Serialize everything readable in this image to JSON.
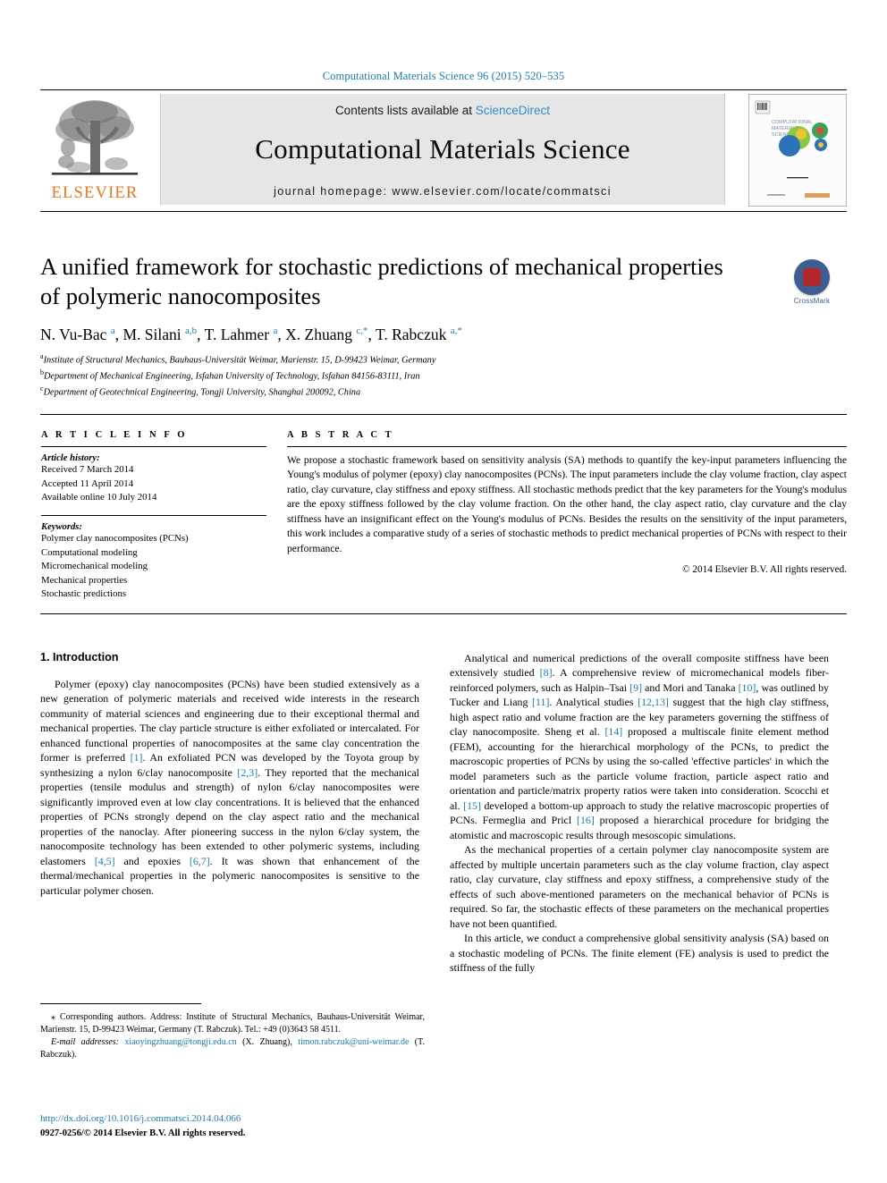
{
  "running_head": "Computational Materials Science 96 (2015) 520–535",
  "masthead": {
    "contents_prefix": "Contents lists available at ",
    "sciencedirect": "ScienceDirect",
    "journal_title": "Computational Materials Science",
    "journal_homepage": "journal homepage: www.elsevier.com/locate/commatsci",
    "publisher_logo_text": "ELSEVIER",
    "cover_thumb_title": "COMPUTATIONAL MATERIALS SCIENCE",
    "accent_color": "#1b7bb5",
    "elsevier_orange": "#E87722"
  },
  "title_block": {
    "title": "A unified framework for stochastic predictions of mechanical properties of polymeric nanocomposites",
    "crossmark_label": "CrossMark",
    "authors_html": "N. Vu-Bac <sup>a</sup>, M. Silani <sup>a,b</sup>, T. Lahmer <sup>a</sup>, X. Zhuang <sup>c,</sup><sup>*</sup>, T. Rabczuk <sup>a,</sup><sup>*</sup>",
    "affiliations": [
      "Institute of Structural Mechanics, Bauhaus-Universität Weimar, Marienstr. 15, D-99423 Weimar, Germany",
      "Department of Mechanical Engineering, Isfahan University of Technology, Isfahan 84156-83111, Iran",
      "Department of Geotechnical Engineering, Tongji University, Shanghai 200092, China"
    ],
    "affiliation_marks": [
      "a",
      "b",
      "c"
    ]
  },
  "article_info": {
    "heading": "A R T I C L E   I N F O",
    "history_label": "Article history:",
    "history": [
      "Received 7 March 2014",
      "Accepted 11 April 2014",
      "Available online 10 July 2014"
    ],
    "keywords_label": "Keywords:",
    "keywords": [
      "Polymer clay nanocomposites (PCNs)",
      "Computational modeling",
      "Micromechanical modeling",
      "Mechanical properties",
      "Stochastic predictions"
    ]
  },
  "abstract": {
    "heading": "A B S T R A C T",
    "text": "We propose a stochastic framework based on sensitivity analysis (SA) methods to quantify the key-input parameters influencing the Young's modulus of polymer (epoxy) clay nanocomposites (PCNs). The input parameters include the clay volume fraction, clay aspect ratio, clay curvature, clay stiffness and epoxy stiffness. All stochastic methods predict that the key parameters for the Young's modulus are the epoxy stiffness followed by the clay volume fraction. On the other hand, the clay aspect ratio, clay curvature and the clay stiffness have an insignificant effect on the Young's modulus of PCNs. Besides the results on the sensitivity of the input parameters, this work includes a comparative study of a series of stochastic methods to predict mechanical properties of PCNs with respect to their performance.",
    "copyright": "© 2014 Elsevier B.V. All rights reserved."
  },
  "body": {
    "section_number_title": "1. Introduction",
    "left_paragraphs": [
      {
        "parts": [
          {
            "t": "Polymer (epoxy) clay nanocomposites (PCNs) have been studied extensively as a new generation of polymeric materials and received wide interests in the research community of material sciences and engineering due to their exceptional thermal and mechanical properties. The clay particle structure is either exfoliated or intercalated. For enhanced functional properties of nanocomposites at the same clay concentration the former is preferred "
          },
          {
            "t": "[1]",
            "ref": true
          },
          {
            "t": ". An exfoliated PCN was developed by the Toyota group by synthesizing a nylon 6/clay nanocomposite "
          },
          {
            "t": "[2,3]",
            "ref": true
          },
          {
            "t": ". They reported that the mechanical properties (tensile modulus and strength) of nylon 6/clay nanocomposites were significantly improved even at low clay concentrations. It is believed that the enhanced properties of PCNs strongly depend on the clay aspect ratio and the mechanical properties of the nanoclay. After pioneering success in the nylon 6/clay system, the nanocomposite technology has been extended to other polymeric systems, including elastomers "
          },
          {
            "t": "[4,5]",
            "ref": true
          },
          {
            "t": " and epoxies "
          },
          {
            "t": "[6,7]",
            "ref": true
          },
          {
            "t": ". It was shown that enhancement of the thermal/mechanical properties in the polymeric nanocomposites is sensitive to the particular polymer chosen."
          }
        ]
      }
    ],
    "right_paragraphs": [
      {
        "parts": [
          {
            "t": "Analytical and numerical predictions of the overall composite stiffness have been extensively studied "
          },
          {
            "t": "[8]",
            "ref": true
          },
          {
            "t": ". A comprehensive review of micromechanical models fiber-reinforced polymers, such as Halpin–Tsai "
          },
          {
            "t": "[9]",
            "ref": true
          },
          {
            "t": " and Mori and Tanaka "
          },
          {
            "t": "[10]",
            "ref": true
          },
          {
            "t": ", was outlined by Tucker and Liang "
          },
          {
            "t": "[11]",
            "ref": true
          },
          {
            "t": ". Analytical studies "
          },
          {
            "t": "[12,13]",
            "ref": true
          },
          {
            "t": " suggest that the high clay stiffness, high aspect ratio and volume fraction are the key parameters governing the stiffness of clay nanocomposite. Sheng et al. "
          },
          {
            "t": "[14]",
            "ref": true
          },
          {
            "t": " proposed a multiscale finite element method (FEM), accounting for the hierarchical morphology of the PCNs, to predict the macroscopic properties of PCNs by using the so-called 'effective particles' in which the model parameters such as the particle volume fraction, particle aspect ratio and orientation and particle/matrix property ratios were taken into consideration. Scocchi et al. "
          },
          {
            "t": "[15]",
            "ref": true
          },
          {
            "t": " developed a bottom-up approach to study the relative macroscopic properties of PCNs. Fermeglia and Pricl "
          },
          {
            "t": "[16]",
            "ref": true
          },
          {
            "t": " proposed a hierarchical procedure for bridging the atomistic and macroscopic results through mesoscopic simulations."
          }
        ]
      },
      {
        "parts": [
          {
            "t": "As the mechanical properties of a certain polymer clay nanocomposite system are affected by multiple uncertain parameters such as the clay volume fraction, clay aspect ratio, clay curvature, clay stiffness and epoxy stiffness, a comprehensive study of the effects of such above-mentioned parameters on the mechanical behavior of PCNs is required. So far, the stochastic effects of these parameters on the mechanical properties have not been quantified."
          }
        ]
      },
      {
        "parts": [
          {
            "t": "In this article, we conduct a comprehensive global sensitivity analysis (SA) based on a stochastic modeling of PCNs. The finite element (FE) analysis is used to predict the stiffness of the fully"
          }
        ]
      }
    ]
  },
  "footnotes": {
    "corresponding_mark": "⁎",
    "corresponding_text": " Corresponding authors. Address: Institute of Structural Mechanics, Bauhaus-Universität Weimar, Marienstr. 15, D-99423 Weimar, Germany (T. Rabczuk). Tel.: +49 (0)3643 58 4511.",
    "email_label": "E-mail addresses:",
    "email_1": "xiaoyingzhuang@tongji.edu.cn",
    "email_1_who": " (X. Zhuang), ",
    "email_2": "timon.rabczuk@uni-weimar.de",
    "email_2_who": " (T. Rabczuk).",
    "doi": "http://dx.doi.org/10.1016/j.commatsci.2014.04.066",
    "issn_line": "0927-0256/© 2014 Elsevier B.V. All rights reserved."
  }
}
